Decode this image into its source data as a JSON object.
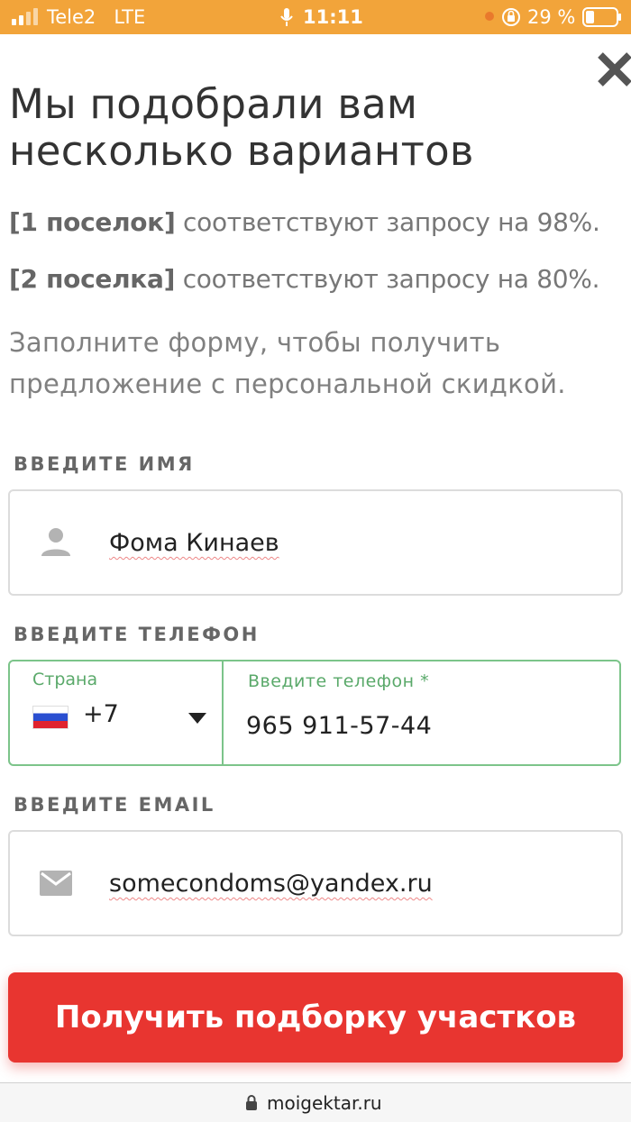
{
  "status_bar": {
    "carrier": "Tele2",
    "network": "LTE",
    "time": "11:11",
    "battery": "29 %"
  },
  "modal": {
    "title": "Мы подобрали вам несколько вариантов",
    "match1_bold": "[1 поселок]",
    "match1_text": " соответствуют запросу на 98%.",
    "match2_bold": "[2 поселка]",
    "match2_text": " соответствуют запросу на 80%.",
    "description": "Заполните форму, чтобы получить предложение с персональной скидкой."
  },
  "form": {
    "name_label": "ВВЕДИТЕ ИМЯ",
    "name_value": "Фома Кинаев",
    "phone_label": "ВВЕДИТЕ ТЕЛЕФОН",
    "country_label": "Страна",
    "country_code": "+7",
    "phone_placeholder": "Введите телефон *",
    "phone_value": "965 911-57-44",
    "email_label": "ВВЕДИТЕ EMAIL",
    "email_value": "somecondoms@yandex.ru",
    "submit_label": "Получить подборку участков"
  },
  "browser": {
    "url": "moigektar.ru"
  },
  "colors": {
    "status_bar": "#f2a43a",
    "accent_green": "#7cc48a",
    "submit_red": "#e83530"
  },
  "icons": {
    "close": "close-icon",
    "name": "person-icon",
    "email": "mail-icon",
    "flag": "russia-flag-icon",
    "dropdown": "caret-down-icon",
    "lock": "lock-icon"
  }
}
